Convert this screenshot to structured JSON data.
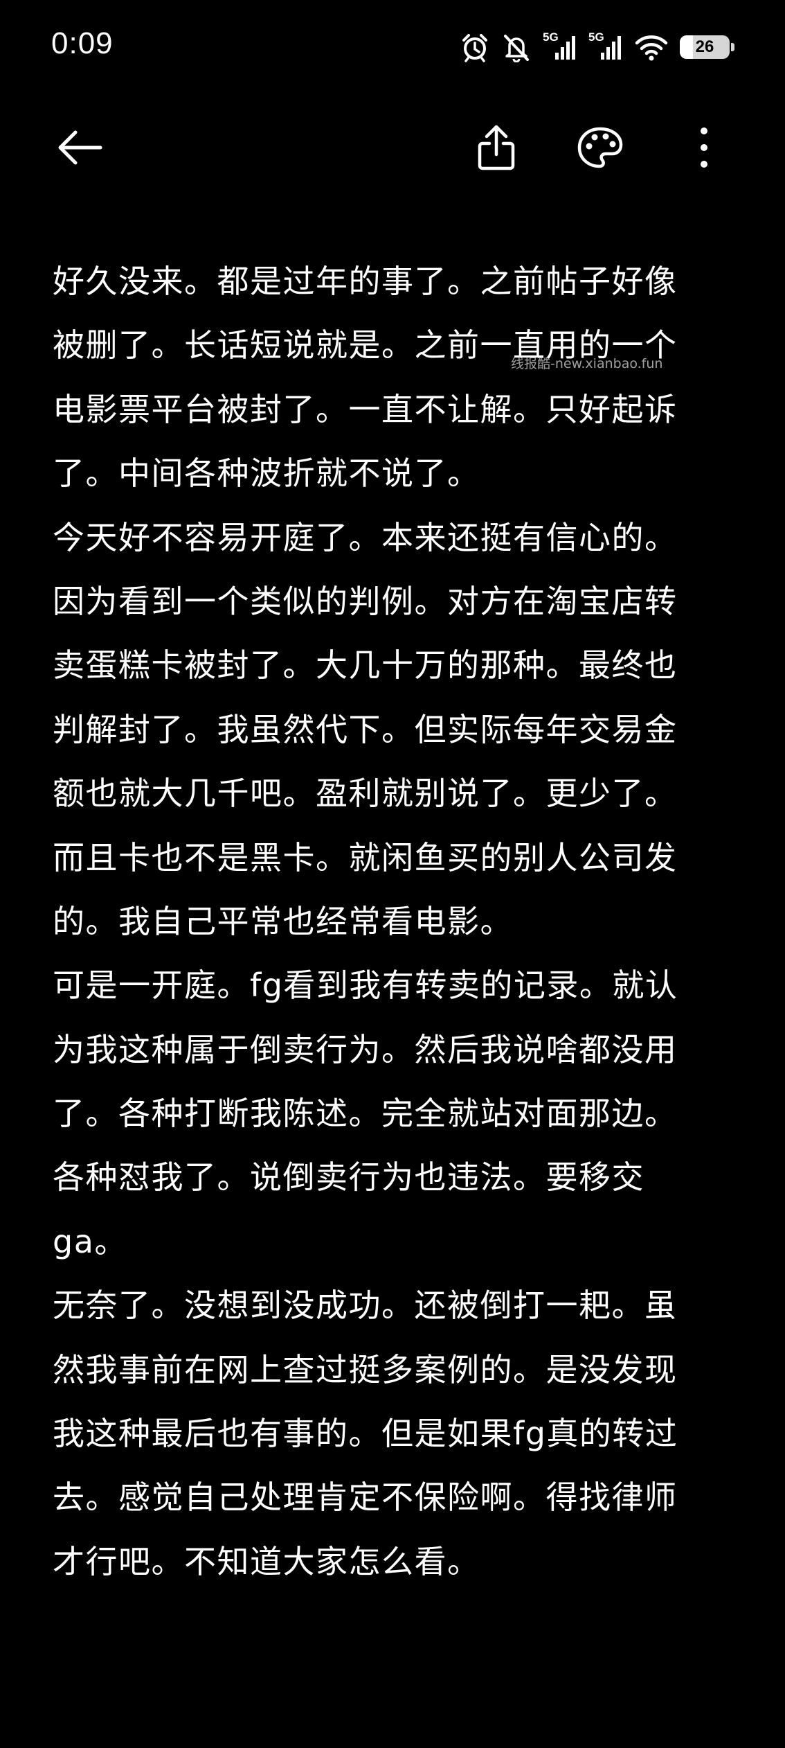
{
  "status_bar": {
    "time": "0:09",
    "network_1": "5G",
    "network_2": "5G",
    "battery_level": 26,
    "battery_text": "26",
    "icons": [
      "alarm-icon",
      "mute-icon",
      "signal-5g-icon",
      "signal-5g-icon",
      "wifi-icon",
      "battery-icon"
    ]
  },
  "toolbar": {
    "icons": [
      "back-arrow-icon",
      "share-icon",
      "palette-icon",
      "more-vertical-icon"
    ]
  },
  "watermark": "线报酷-new.xianbao.fun",
  "note": {
    "lines": [
      "好久没来。都是过年的事了。之前帖子好像",
      "被删了。长话短说就是。之前一直用的一个",
      "电影票平台被封了。一直不让解。只好起诉",
      "了。中间各种波折就不说了。",
      "今天好不容易开庭了。本来还挺有信心的。",
      "因为看到一个类似的判例。对方在淘宝店转",
      "卖蛋糕卡被封了。大几十万的那种。最终也",
      "判解封了。我虽然代下。但实际每年交易金",
      "额也就大几千吧。盈利就别说了。更少了。",
      "而且卡也不是黑卡。就闲鱼买的别人公司发",
      "的。我自己平常也经常看电影。",
      "可是一开庭。fg看到我有转卖的记录。就认",
      "为我这种属于倒卖行为。然后我说啥都没用",
      "了。各种打断我陈述。完全就站对面那边。",
      "各种怼我了。说倒卖行为也违法。要移交",
      "ga。",
      "无奈了。没想到没成功。还被倒打一耙。虽",
      "然我事前在网上查过挺多案例的。是没发现",
      "我这种最后也有事的。但是如果fg真的转过",
      "去。感觉自己处理肯定不保险啊。得找律师",
      "才行吧。不知道大家怎么看。"
    ]
  },
  "colors": {
    "background": "#000000",
    "text": "#ffffff",
    "icon": "#ffffff"
  }
}
